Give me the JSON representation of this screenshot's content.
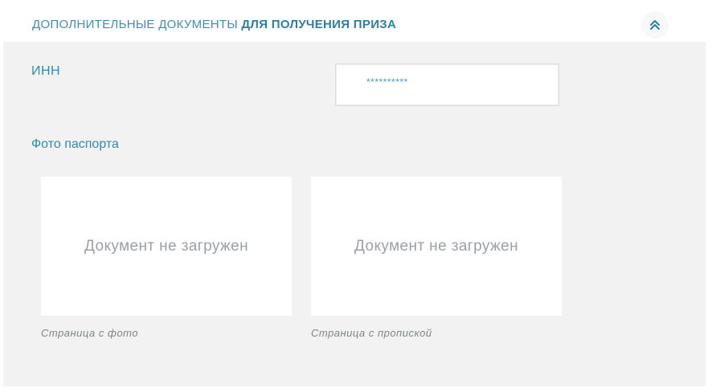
{
  "header": {
    "title_light": "ДОПОЛНИТЕЛЬНЫЕ ДОКУМЕНТЫ",
    "title_bold": "ДЛЯ ПОЛУЧЕНИЯ ПРИЗА",
    "collapse_icon": "chevron-double-up-icon"
  },
  "inn": {
    "label": "ИНН",
    "value": "**********"
  },
  "passport": {
    "label": "Фото паспорта",
    "documents": [
      {
        "status": "Документ не загружен",
        "caption": "Страница с фото"
      },
      {
        "status": "Документ не загружен",
        "caption": "Страница с пропиской"
      }
    ]
  },
  "colors": {
    "accent": "#2f8bb3",
    "panel_bg": "#f2f2f2",
    "placeholder_text": "#9aa1a8"
  }
}
